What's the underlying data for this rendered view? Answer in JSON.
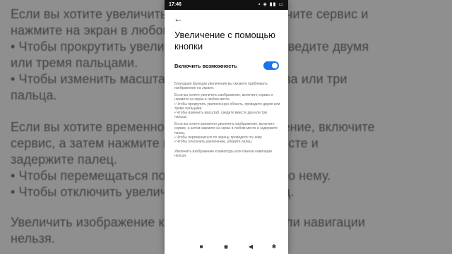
{
  "background": {
    "lines": [
      "Если вы хотите увеличить изображение, включите сервис и",
      "нажмите на экран в любом месте.",
      "• Чтобы прокрутить увеличенную область, проведите двумя",
      "или тремя пальцами.",
      "• Чтобы изменить масштаб, сведите вместе два или три",
      "пальца.",
      "",
      "Если вы хотите временно увеличить изображение, включите",
      "сервис, а затем нажмите на экран в любом месте и",
      "задержите палец.",
      "• Чтобы перемещаться по экрану, проведите по нему.",
      "• Чтобы отключить увеличение, уберите палец.",
      "",
      "Увеличить изображение клавиатуры или панели навигации",
      "нельзя."
    ]
  },
  "status": {
    "time": "17:46",
    "icons": "▪ ◈ ▮▮ ▭"
  },
  "screen": {
    "back_icon": "←",
    "title": "Увеличение с помощью кнопки",
    "toggle_label": "Включить возможность",
    "toggle_on": true,
    "paragraphs": [
      "Благодаря функции увеличения вы сможете приближать изображение на экране.",
      "Если вы хотите увеличить изображение, включите сервис и нажмите на экран в любом месте.\n• Чтобы прокрутить увеличенную область, проведите двумя или тремя пальцами.\n• Чтобы изменить масштаб, сведите вместе два или три пальца.",
      "Если вы хотите временно увеличить изображение, включите сервис, а затем нажмите на экран в любом месте и задержите палец.\n• Чтобы перемещаться по экрану, проведите по нему.\n• Чтобы отключить увеличение, уберите палец.",
      "Увеличить изображение клавиатуры или панели навигации нельзя."
    ]
  },
  "navbar": {
    "square_icon": "■",
    "home_icon": "◉",
    "back_icon": "◀",
    "accessibility_icon": "✱"
  },
  "colors": {
    "accent": "#1a73e8"
  }
}
